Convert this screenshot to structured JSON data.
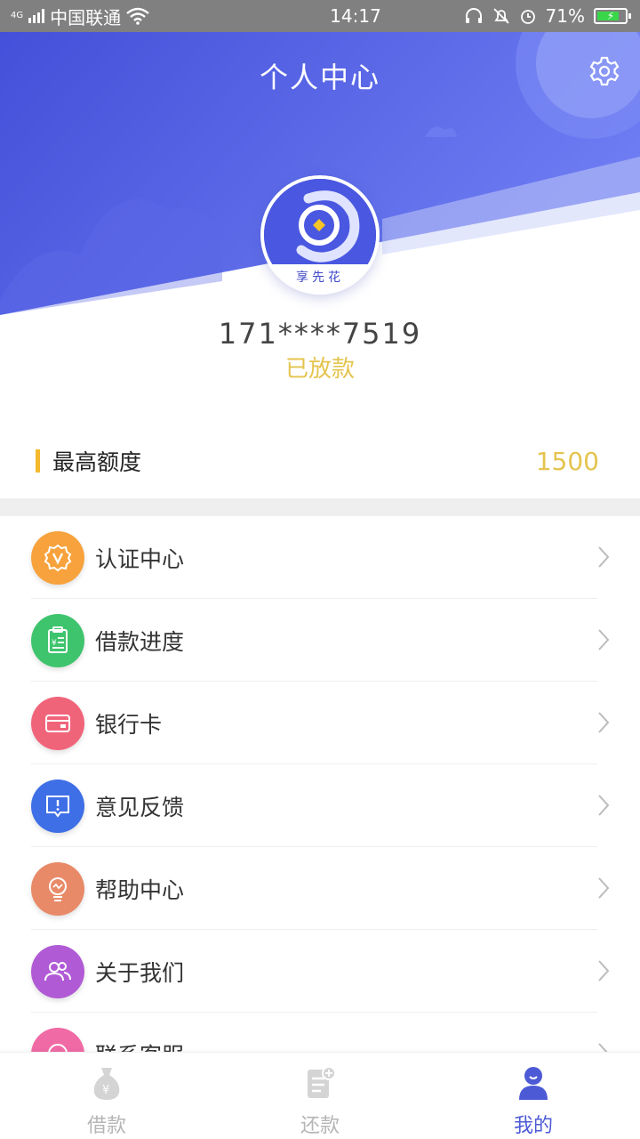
{
  "status_bar": {
    "network_tag": "4G",
    "carrier": "中国联通",
    "time": "14:17",
    "battery_percent": "71%",
    "battery_level": 0.71
  },
  "header": {
    "title": "个人中心",
    "settings_icon": "gear-icon"
  },
  "profile": {
    "brand_text": "享先花",
    "phone_masked": "171****7519",
    "loan_status": "已放款"
  },
  "credit_limit": {
    "label": "最高额度",
    "value": "1500"
  },
  "menu": {
    "items": [
      {
        "label": "认证中心",
        "icon": "badge-v-icon",
        "color": "#f7a23c"
      },
      {
        "label": "借款进度",
        "icon": "clipboard-yen-icon",
        "color": "#3fc46e"
      },
      {
        "label": "银行卡",
        "icon": "bank-card-icon",
        "color": "#f0647a"
      },
      {
        "label": "意见反馈",
        "icon": "feedback-icon",
        "color": "#3f6fe6"
      },
      {
        "label": "帮助中心",
        "icon": "lightbulb-icon",
        "color": "#e88a68"
      },
      {
        "label": "关于我们",
        "icon": "users-icon",
        "color": "#b15ad6"
      },
      {
        "label": "联系客服",
        "icon": "headset-icon",
        "color": "#f06aa5"
      }
    ]
  },
  "tabbar": {
    "tabs": [
      {
        "label": "借款",
        "icon": "money-bag-icon",
        "active": false
      },
      {
        "label": "还款",
        "icon": "bill-icon",
        "active": false
      },
      {
        "label": "我的",
        "icon": "person-icon",
        "active": true
      }
    ]
  },
  "colors": {
    "header_blue": "#4a57e0",
    "accent_gold": "#e4c44e",
    "tab_active": "#4d5ad6"
  }
}
